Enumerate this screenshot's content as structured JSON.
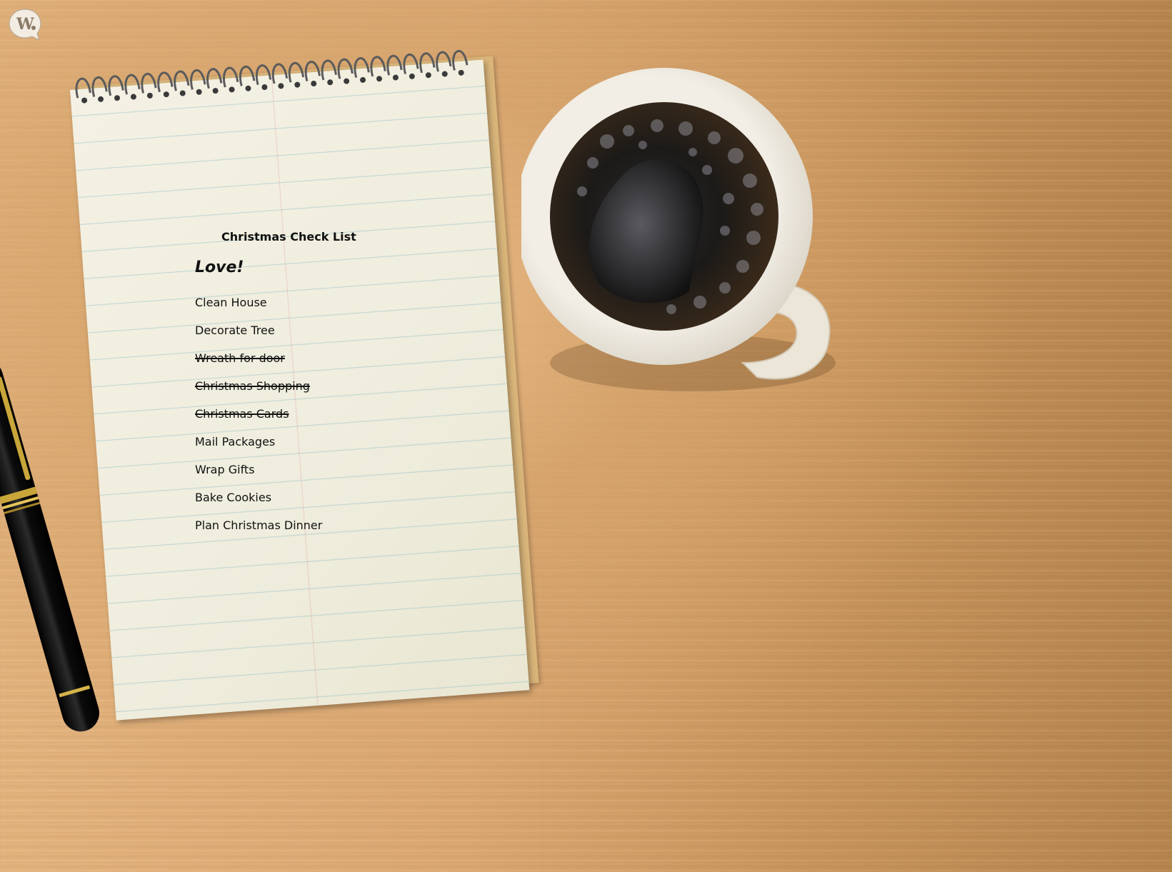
{
  "checklist": {
    "title": "Christmas Check List",
    "heading": "Love!",
    "items": [
      {
        "label": "Clean House",
        "done": false
      },
      {
        "label": "Decorate Tree",
        "done": false
      },
      {
        "label": "Wreath for door",
        "done": true
      },
      {
        "label": "Christmas Shopping",
        "done": true
      },
      {
        "label": "Christmas Cards",
        "done": true
      },
      {
        "label": "Mail Packages",
        "done": false
      },
      {
        "label": "Wrap Gifts",
        "done": false
      },
      {
        "label": "Bake Cookies",
        "done": false
      },
      {
        "label": "Plan Christmas Dinner",
        "done": false
      }
    ]
  },
  "icons": {
    "logo": "chat-bubble-w-logo",
    "cup": "coffee-cup-icon",
    "pen": "fountain-pen-icon",
    "spiral": "spiral-binding"
  },
  "colors": {
    "desk": "#dca872",
    "paper": "#f1eedf",
    "ink": "#111111",
    "coffee": "#1a1714"
  }
}
